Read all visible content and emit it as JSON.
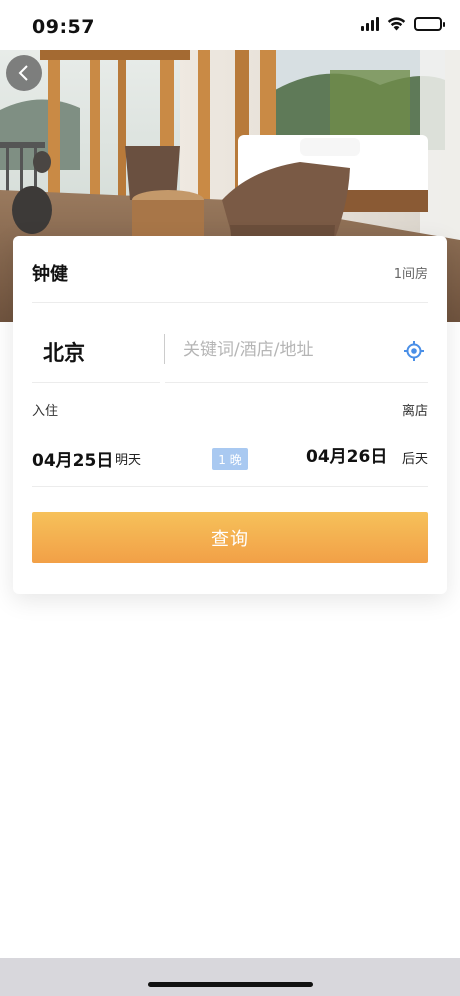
{
  "status_bar": {
    "time": "09:57",
    "icons": [
      "signal-icon",
      "wifi-icon",
      "battery-icon"
    ]
  },
  "hero": {
    "image": "hotel-balcony-photo",
    "back_icon": "chevron-left-icon"
  },
  "booking": {
    "guest_name": "钟健",
    "room_count": "1间房",
    "city": "北京",
    "keyword_placeholder": "关键词/酒店/地址",
    "keyword_value": "",
    "location_icon": "locate-icon",
    "checkin_label": "入住",
    "checkout_label": "离店",
    "checkin_date": "04月25日",
    "checkin_day": "明天",
    "nights": "1 晚",
    "checkout_date": "04月26日",
    "checkout_day": "后天",
    "search_label": "查询"
  },
  "colors": {
    "accent_top": "#f6c15a",
    "accent_bottom": "#f2a047",
    "nights_badge": "#a9c9f1",
    "locate_icon": "#4a8fe7"
  }
}
